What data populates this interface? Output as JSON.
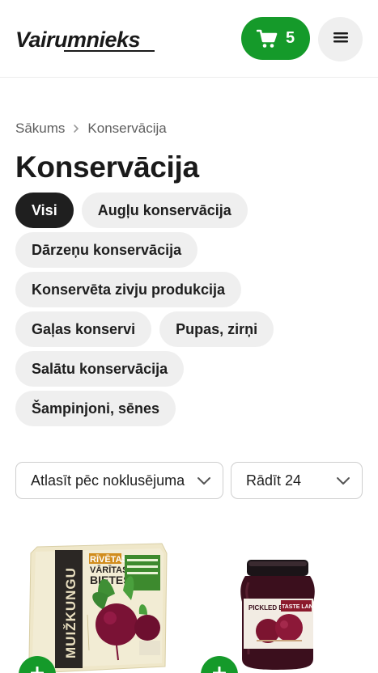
{
  "header": {
    "logo_text": "Vairumnieks",
    "cart_count": "5",
    "cart_icon": "shopping-cart-icon",
    "menu_icon": "hamburger-menu-icon"
  },
  "breadcrumb": {
    "home": "Sākums",
    "current": "Konservācija"
  },
  "page": {
    "title": "Konservācija"
  },
  "categories": [
    {
      "label": "Visi",
      "active": true
    },
    {
      "label": "Augļu konservācija",
      "active": false
    },
    {
      "label": "Dārzeņu konservācija",
      "active": false
    },
    {
      "label": "Konservēta zivju produkcija",
      "active": false
    },
    {
      "label": "Gaļas konservi",
      "active": false
    },
    {
      "label": "Pupas, zirņi",
      "active": false
    },
    {
      "label": "Salātu konservācija",
      "active": false
    },
    {
      "label": "Šampinjoni, sēnes",
      "active": false
    }
  ],
  "controls": {
    "sort_value": "Atlasīt pēc noklusējuma",
    "per_page_value": "Rādīt 24"
  },
  "products": [
    {
      "brand": "MUIŽKUNGU",
      "pack_line1": "RĪVĒTAS",
      "pack_line2": "VĀRĪTAS",
      "pack_line3": "BIETES"
    },
    {
      "jar_label": "PICKLED BEETS",
      "jar_brand": "TASTE LAND"
    }
  ],
  "colors": {
    "accent": "#159a2a",
    "chip_bg": "#efefef",
    "chip_active_bg": "#1f1f1f"
  }
}
